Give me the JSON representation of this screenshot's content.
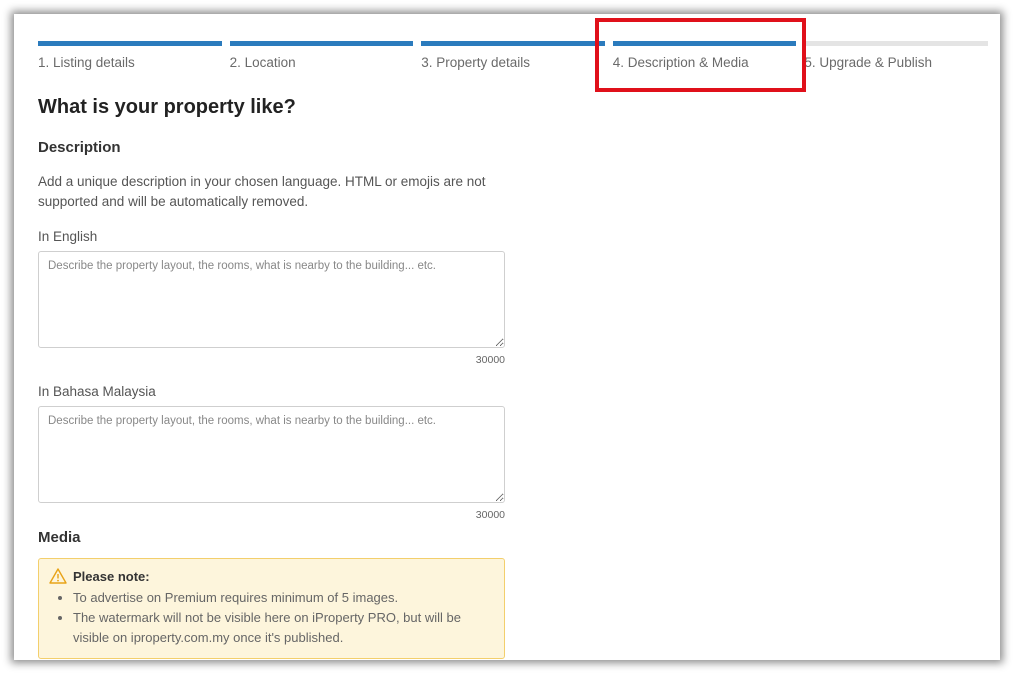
{
  "steps": [
    {
      "label": "1. Listing details",
      "state": "done"
    },
    {
      "label": "2. Location",
      "state": "done"
    },
    {
      "label": "3. Property details",
      "state": "done"
    },
    {
      "label": "4. Description & Media",
      "state": "current"
    },
    {
      "label": "5. Upgrade & Publish",
      "state": "pending"
    }
  ],
  "page_title": "What is your property like?",
  "description": {
    "heading": "Description",
    "help": "Add a unique description in your chosen language. HTML or emojis are not supported and will be automatically removed.",
    "english": {
      "label": "In English",
      "value": "",
      "placeholder": "Describe the property layout, the rooms, what is nearby to the building... etc.",
      "counter": "30000"
    },
    "malay": {
      "label": "In Bahasa Malaysia",
      "value": "",
      "placeholder": "Describe the property layout, the rooms, what is nearby to the building... etc.",
      "counter": "30000"
    }
  },
  "media": {
    "heading": "Media",
    "note_title": "Please note:",
    "note_items": [
      "To advertise on Premium requires minimum of 5 images.",
      "The watermark will not be visible here on iProperty PRO, but will be visible on iproperty.com.my once it's published."
    ]
  },
  "colors": {
    "step_active": "#2b7bbd",
    "step_inactive": "#e4e4e4",
    "highlight": "#e0101a",
    "note_bg": "#fdf5dc",
    "note_border": "#f3cf6c"
  }
}
